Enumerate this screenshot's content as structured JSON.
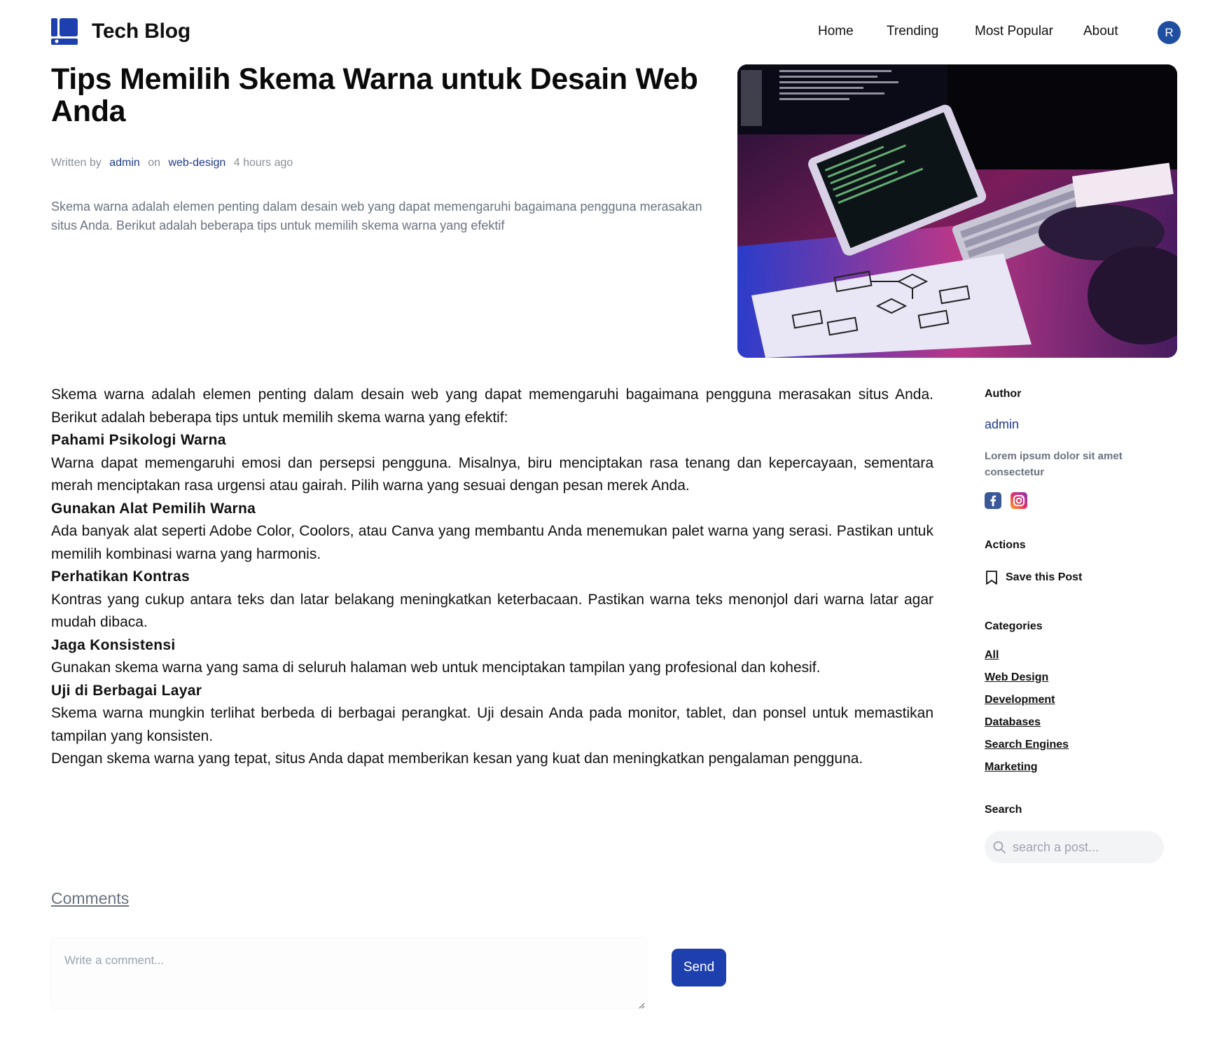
{
  "site": {
    "title": "Tech Blog"
  },
  "nav": {
    "items": [
      "Home",
      "Trending",
      "Most Popular",
      "About"
    ],
    "avatar_initial": "R"
  },
  "post": {
    "title": "Tips Memilih Skema Warna untuk Desain Web Anda",
    "meta": {
      "written_by_label": "Written by",
      "author": "admin",
      "on_label": "on",
      "category": "web-design",
      "time": "4 hours ago"
    },
    "excerpt": "Skema warna adalah elemen penting dalam desain web yang dapat memengaruhi bagaimana pengguna merasakan situs Anda. Berikut adalah beberapa tips untuk memilih skema warna yang efektif",
    "intro": "Skema warna adalah elemen penting dalam desain web yang dapat memengaruhi bagaimana pengguna merasakan situs Anda. Berikut adalah beberapa tips untuk memilih skema warna yang efektif:",
    "sections": [
      {
        "heading": "Pahami Psikologi Warna",
        "text": "Warna dapat memengaruhi emosi dan persepsi pengguna. Misalnya, biru menciptakan rasa tenang dan kepercayaan, sementara merah menciptakan rasa urgensi atau gairah. Pilih warna yang sesuai dengan pesan merek Anda."
      },
      {
        "heading": "Gunakan Alat Pemilih Warna",
        "text": "Ada banyak alat seperti Adobe Color, Coolors, atau Canva yang membantu Anda menemukan palet warna yang serasi. Pastikan untuk memilih kombinasi warna yang harmonis."
      },
      {
        "heading": "Perhatikan Kontras",
        "text": "Kontras yang cukup antara teks dan latar belakang meningkatkan keterbacaan. Pastikan warna teks menonjol dari warna latar agar mudah dibaca."
      },
      {
        "heading": "Jaga Konsistensi",
        "text": "Gunakan skema warna yang sama di seluruh halaman web untuk menciptakan tampilan yang profesional dan kohesif."
      },
      {
        "heading": "Uji di Berbagai Layar",
        "text": "Skema warna mungkin terlihat berbeda di berbagai perangkat. Uji desain Anda pada monitor, tablet, dan ponsel untuk memastikan tampilan yang konsisten."
      }
    ],
    "outro": "Dengan skema warna yang tepat, situs Anda dapat memberikan kesan yang kuat dan meningkatkan pengalaman pengguna."
  },
  "sidebar": {
    "author_heading": "Author",
    "author_name": "admin",
    "author_bio": "Lorem ipsum dolor sit amet consectetur",
    "social_icons": [
      "facebook-icon",
      "instagram-icon"
    ],
    "actions_heading": "Actions",
    "save_label": "Save this Post",
    "categories_heading": "Categories",
    "categories": [
      "All",
      "Web Design",
      "Development",
      "Databases",
      "Search Engines",
      "Marketing"
    ],
    "search_heading": "Search",
    "search_placeholder": "search a post..."
  },
  "comments": {
    "heading": "Comments",
    "placeholder": "Write a comment...",
    "send_label": "Send"
  },
  "colors": {
    "brand": "#1e40af",
    "link": "#1e3a8a",
    "avatar": "#1f4ea1",
    "muted": "#6b7280"
  }
}
